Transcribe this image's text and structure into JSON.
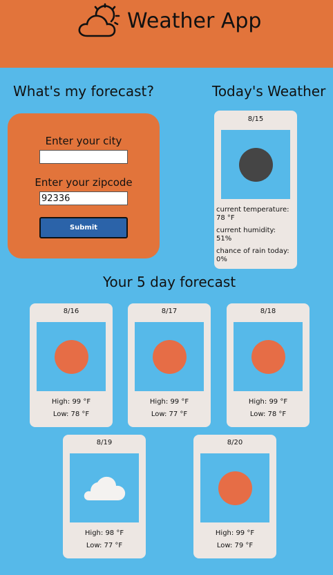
{
  "header": {
    "app_title": "Weather App",
    "background_color": "#e2743b",
    "logo_icon": "sun-behind-cloud-icon"
  },
  "form": {
    "title": "What's my forecast?",
    "city_label": "Enter your city",
    "city_value": "",
    "zip_label": "Enter your zipcode",
    "zip_value": "92336",
    "submit_label": "Submit"
  },
  "today": {
    "title": "Today's Weather",
    "date": "8/15",
    "icon": "moon-icon",
    "temperature_label": "current temperature:",
    "temperature_value": "78 °F",
    "humidity_label": "current humidity:",
    "humidity_value": "51%",
    "rain_label": "chance of rain today:",
    "rain_value": "0%"
  },
  "forecast": {
    "title": "Your 5 day forecast",
    "days": [
      {
        "date": "8/16",
        "icon": "sun-icon",
        "high": "High: 99 °F",
        "low": "Low: 78 °F"
      },
      {
        "date": "8/17",
        "icon": "sun-icon",
        "high": "High: 99 °F",
        "low": "Low: 77 °F"
      },
      {
        "date": "8/18",
        "icon": "sun-icon",
        "high": "High: 99 °F",
        "low": "Low: 78 °F"
      },
      {
        "date": "8/19",
        "icon": "cloud-icon",
        "high": "High: 98 °F",
        "low": "Low: 77 °F"
      },
      {
        "date": "8/20",
        "icon": "sun-icon",
        "high": "High: 99 °F",
        "low": "Low: 79 °F"
      }
    ]
  },
  "colors": {
    "page_background": "#56b9e9",
    "accent_orange": "#e2743b",
    "card_background": "#ede7e3",
    "sun": "#e66d46",
    "moon": "#454545",
    "cloud": "#f4f2f0",
    "button": "#2b63a9"
  }
}
